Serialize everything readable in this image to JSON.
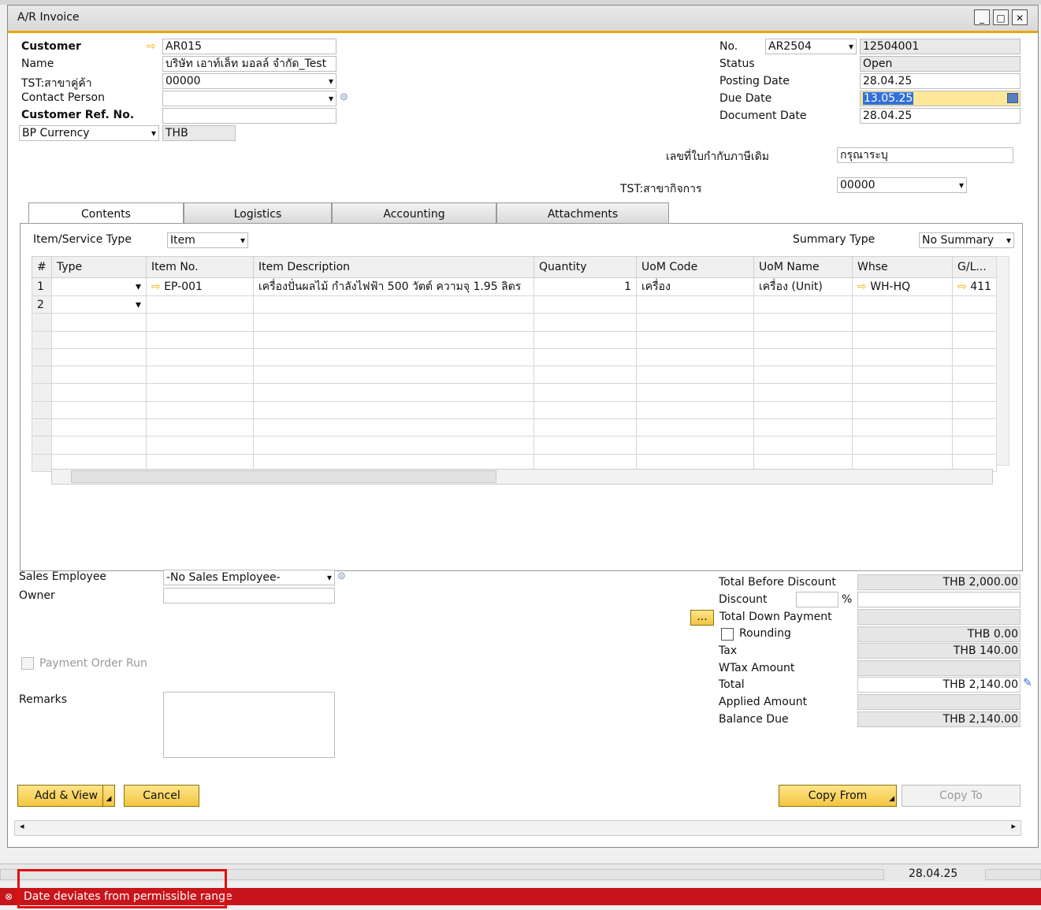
{
  "window": {
    "title": "A/R Invoice"
  },
  "header_left": {
    "customer_label": "Customer",
    "customer_value": "AR015",
    "name_label": "Name",
    "name_value": "บริษัท เอาท์เล็ท มอลล์ จำกัด_Test",
    "branch_label": "TST:สาขาคู่ค้า",
    "branch_value": "00000",
    "contact_label": "Contact Person",
    "contact_value": "",
    "ref_label": "Customer Ref. No.",
    "ref_value": "",
    "currency_label": "BP Currency",
    "currency_value": "THB"
  },
  "header_right": {
    "no_label": "No.",
    "series_value": "AR2504",
    "no_value": "12504001",
    "status_label": "Status",
    "status_value": "Open",
    "posting_label": "Posting Date",
    "posting_value": "28.04.25",
    "due_label": "Due Date",
    "due_value": "13.05.25",
    "docdate_label": "Document Date",
    "docdate_value": "28.04.25",
    "taxref_label": "เลขที่ใบกำกับภาษีเดิม",
    "taxref_value": "กรุณาระบุ",
    "bizbranch_label": "TST:สาขากิจการ",
    "bizbranch_value": "00000"
  },
  "tabs": [
    {
      "label": "Contents"
    },
    {
      "label": "Logistics"
    },
    {
      "label": "Accounting"
    },
    {
      "label": "Attachments"
    }
  ],
  "contents": {
    "type_label": "Item/Service Type",
    "type_value": "Item",
    "summary_label": "Summary Type",
    "summary_value": "No Summary",
    "columns": [
      "#",
      "Type",
      "Item No.",
      "Item Description",
      "Quantity",
      "UoM Code",
      "UoM Name",
      "Whse",
      "G/L..."
    ],
    "rows": [
      {
        "num": "1",
        "item_no": "EP-001",
        "desc": "เครื่องปั่นผลไม้ กำลังไฟฟ้า 500 วัตต์ ความจุ 1.95 ลิตร",
        "qty": "1",
        "uom_code": "เครื่อง",
        "uom_name": "เครื่อง (Unit)",
        "whse": "WH-HQ",
        "gl": "411"
      },
      {
        "num": "2",
        "item_no": "",
        "desc": "",
        "qty": "",
        "uom_code": "",
        "uom_name": "",
        "whse": "",
        "gl": ""
      }
    ]
  },
  "footer_left": {
    "sales_emp_label": "Sales Employee",
    "sales_emp_value": "-No Sales Employee-",
    "owner_label": "Owner",
    "owner_value": "",
    "payment_run_label": "Payment Order Run",
    "remarks_label": "Remarks"
  },
  "totals": {
    "before_discount_label": "Total Before Discount",
    "before_discount_value": "THB 2,000.00",
    "discount_label": "Discount",
    "discount_pct": "%",
    "down_payment_label": "Total Down Payment",
    "rounding_label": "Rounding",
    "rounding_value": "THB 0.00",
    "tax_label": "Tax",
    "tax_value": "THB 140.00",
    "wtax_label": "WTax Amount",
    "total_label": "Total",
    "total_value": "THB 2,140.00",
    "applied_label": "Applied Amount",
    "balance_label": "Balance Due",
    "balance_value": "THB 2,140.00",
    "more_button": "..."
  },
  "buttons": {
    "add_view": "Add & View",
    "cancel": "Cancel",
    "copy_from": "Copy From",
    "copy_to": "Copy To"
  },
  "statusbar": {
    "date": "28.04.25",
    "error_message": "Date deviates from permissible range"
  },
  "colors": {
    "accent": "#e8a800",
    "error": "#c8151b",
    "selection": "#3170d8"
  }
}
